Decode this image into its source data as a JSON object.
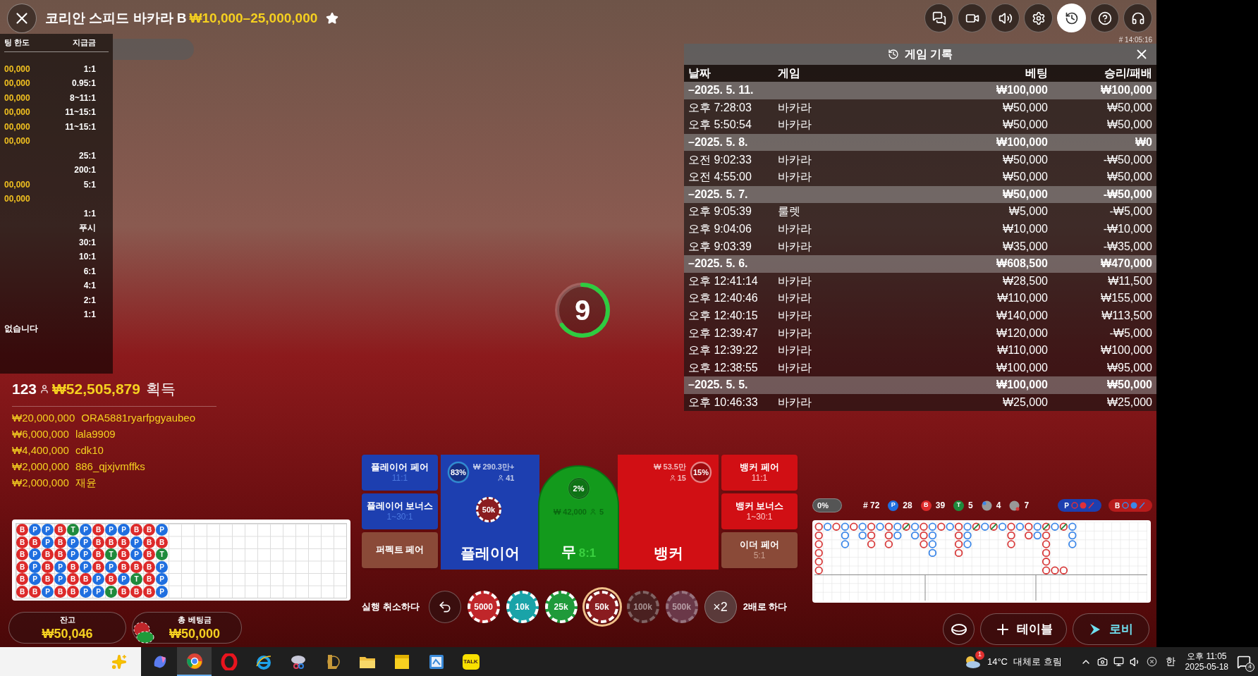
{
  "header": {
    "title": "코리안 스피드 바카라 B",
    "limits": "₩10,000–25,000,000"
  },
  "paytable": {
    "columns": [
      "팅 한도",
      "지급금"
    ],
    "rows": [
      {
        "limit": "00,000",
        "payout": "1:1"
      },
      {
        "limit": "00,000",
        "payout": "0.95:1"
      },
      {
        "limit": "00,000",
        "payout": "8~11:1"
      },
      {
        "limit": "00,000",
        "payout": "11~15:1"
      },
      {
        "limit": "00,000",
        "payout": "11~15:1"
      },
      {
        "limit": "00,000"
      },
      {
        "payout": "25:1"
      },
      {
        "payout": "200:1"
      },
      {
        "limit": "00,000",
        "payout": "5:1"
      },
      {
        "limit": "00,000"
      },
      {
        "payout": "1:1"
      },
      {
        "payout": "푸시"
      },
      {
        "payout": "30:1"
      },
      {
        "payout": "10:1"
      },
      {
        "payout": "6:1"
      },
      {
        "payout": "4:1"
      },
      {
        "payout": "2:1"
      },
      {
        "payout": "1:1"
      }
    ],
    "footer": "없습니다"
  },
  "toolbar": {
    "buttons": [
      {
        "kind": "chat",
        "selected": false
      },
      {
        "kind": "video",
        "selected": false
      },
      {
        "kind": "sound",
        "selected": false
      },
      {
        "kind": "settings",
        "selected": false
      },
      {
        "kind": "history",
        "selected": true
      },
      {
        "kind": "help",
        "selected": false
      },
      {
        "kind": "support",
        "selected": false
      }
    ],
    "round_id": "# 14:05:16"
  },
  "history": {
    "title": "게임 기록",
    "columns": [
      "날짜",
      "게임",
      "베팅",
      "승리/패배"
    ],
    "rows": [
      {
        "kind": "day",
        "date": "–2025. 5. 11.",
        "bet": "₩100,000",
        "result": "₩100,000"
      },
      {
        "kind": "entry",
        "date": "오후 7:28:03",
        "game": "바카라",
        "bet": "₩50,000",
        "result": "₩50,000"
      },
      {
        "kind": "entry",
        "date": "오후 5:50:54",
        "game": "바카라",
        "bet": "₩50,000",
        "result": "₩50,000"
      },
      {
        "kind": "day",
        "date": "–2025. 5. 8.",
        "bet": "₩100,000",
        "result": "₩0"
      },
      {
        "kind": "entry",
        "date": "오전 9:02:33",
        "game": "바카라",
        "bet": "₩50,000",
        "result": "-₩50,000"
      },
      {
        "kind": "entry",
        "date": "오전 4:55:00",
        "game": "바카라",
        "bet": "₩50,000",
        "result": "₩50,000"
      },
      {
        "kind": "day",
        "date": "–2025. 5. 7.",
        "bet": "₩50,000",
        "result": "-₩50,000"
      },
      {
        "kind": "entry",
        "date": "오후 9:05:39",
        "game": "룰렛",
        "bet": "₩5,000",
        "result": "-₩5,000"
      },
      {
        "kind": "entry",
        "date": "오후 9:04:06",
        "game": "바카라",
        "bet": "₩10,000",
        "result": "-₩10,000"
      },
      {
        "kind": "entry",
        "date": "오후 9:03:39",
        "game": "바카라",
        "bet": "₩35,000",
        "result": "-₩35,000"
      },
      {
        "kind": "day",
        "date": "–2025. 5. 6.",
        "bet": "₩608,500",
        "result": "₩470,000"
      },
      {
        "kind": "entry",
        "date": "오후 12:41:14",
        "game": "바카라",
        "bet": "₩28,500",
        "result": "₩11,500"
      },
      {
        "kind": "entry",
        "date": "오후 12:40:46",
        "game": "바카라",
        "bet": "₩110,000",
        "result": "₩155,000"
      },
      {
        "kind": "entry",
        "date": "오후 12:40:15",
        "game": "바카라",
        "bet": "₩140,000",
        "result": "₩113,500"
      },
      {
        "kind": "entry",
        "date": "오후 12:39:47",
        "game": "바카라",
        "bet": "₩120,000",
        "result": "-₩5,000"
      },
      {
        "kind": "entry",
        "date": "오후 12:39:22",
        "game": "바카라",
        "bet": "₩110,000",
        "result": "₩100,000"
      },
      {
        "kind": "entry",
        "date": "오후 12:38:55",
        "game": "바카라",
        "bet": "₩100,000",
        "result": "₩95,000"
      },
      {
        "kind": "day",
        "date": "–2025. 5. 5.",
        "bet": "₩100,000",
        "result": "₩50,000"
      },
      {
        "kind": "entry",
        "date": "오후 10:46:33",
        "game": "바카라",
        "bet": "₩25,000",
        "result": "₩25,000"
      }
    ]
  },
  "timer": {
    "value": "9",
    "level": 0.65
  },
  "winners": {
    "count": "123",
    "total": "₩52,505,879",
    "suffix": "획득",
    "list": [
      {
        "amount": "₩20,000,000",
        "name": "ORA5881ryarfpgyaubeo"
      },
      {
        "amount": "₩6,000,000",
        "name": "lala9909"
      },
      {
        "amount": "₩4,400,000",
        "name": "cdk10"
      },
      {
        "amount": "₩2,000,000",
        "name": "886_qjxjvmffks"
      },
      {
        "amount": "₩2,000,000",
        "name": "재윤"
      }
    ]
  },
  "bead_road": {
    "rows": [
      [
        {
          "kind": "banker",
          "label": "B"
        },
        {
          "kind": "player",
          "label": "P"
        },
        {
          "kind": "player",
          "label": "P"
        },
        {
          "kind": "banker",
          "label": "B"
        },
        {
          "kind": "tie",
          "label": "T"
        },
        {
          "kind": "player",
          "label": "P"
        },
        {
          "kind": "banker",
          "label": "B"
        },
        {
          "kind": "player",
          "label": "P"
        },
        {
          "kind": "player",
          "label": "P"
        },
        {
          "kind": "banker",
          "label": "B"
        },
        {
          "kind": "banker",
          "label": "B"
        },
        {
          "kind": "player",
          "label": "P"
        }
      ],
      [
        {
          "kind": "banker",
          "label": "B"
        },
        {
          "kind": "banker",
          "label": "B"
        },
        {
          "kind": "player",
          "label": "P"
        },
        {
          "kind": "banker",
          "label": "B"
        },
        {
          "kind": "player",
          "label": "P"
        },
        {
          "kind": "player",
          "label": "P"
        },
        {
          "kind": "banker",
          "label": "B"
        },
        {
          "kind": "banker",
          "label": "B"
        },
        {
          "kind": "banker",
          "label": "B"
        },
        {
          "kind": "player",
          "label": "P"
        },
        {
          "kind": "banker",
          "label": "B"
        },
        {
          "kind": "banker",
          "label": "B"
        }
      ],
      [
        {
          "kind": "banker",
          "label": "B"
        },
        {
          "kind": "player",
          "label": "P"
        },
        {
          "kind": "banker",
          "label": "B"
        },
        {
          "kind": "banker",
          "label": "B"
        },
        {
          "kind": "player",
          "label": "P"
        },
        {
          "kind": "player",
          "label": "P"
        },
        {
          "kind": "banker",
          "label": "B"
        },
        {
          "kind": "tie",
          "label": "T"
        },
        {
          "kind": "banker",
          "label": "B"
        },
        {
          "kind": "player",
          "label": "P"
        },
        {
          "kind": "banker",
          "label": "B"
        },
        {
          "kind": "tie",
          "label": "T"
        }
      ],
      [
        {
          "kind": "banker",
          "label": "B"
        },
        {
          "kind": "player",
          "label": "P"
        },
        {
          "kind": "banker",
          "label": "B"
        },
        {
          "kind": "player",
          "label": "P"
        },
        {
          "kind": "banker",
          "label": "B"
        },
        {
          "kind": "player",
          "label": "P"
        },
        {
          "kind": "banker",
          "label": "B"
        },
        {
          "kind": "player",
          "label": "P"
        },
        {
          "kind": "banker",
          "label": "B"
        },
        {
          "kind": "banker",
          "label": "B"
        },
        {
          "kind": "banker",
          "label": "B"
        },
        {
          "kind": "player",
          "label": "P"
        }
      ],
      [
        {
          "kind": "banker",
          "label": "B"
        },
        {
          "kind": "player",
          "label": "P"
        },
        {
          "kind": "banker",
          "label": "B"
        },
        {
          "kind": "player",
          "label": "P"
        },
        {
          "kind": "banker",
          "label": "B"
        },
        {
          "kind": "banker",
          "label": "B"
        },
        {
          "kind": "player",
          "label": "P"
        },
        {
          "kind": "banker",
          "label": "B"
        },
        {
          "kind": "player",
          "label": "P"
        },
        {
          "kind": "tie",
          "label": "T"
        },
        {
          "kind": "banker",
          "label": "B"
        },
        {
          "kind": "player",
          "label": "P"
        }
      ],
      [
        {
          "kind": "banker",
          "label": "B"
        },
        {
          "kind": "banker",
          "label": "B"
        },
        {
          "kind": "player",
          "label": "P"
        },
        {
          "kind": "banker",
          "label": "B"
        },
        {
          "kind": "banker",
          "label": "B"
        },
        {
          "kind": "player",
          "label": "P"
        },
        {
          "kind": "player",
          "label": "P"
        },
        {
          "kind": "tie",
          "label": "T"
        },
        {
          "kind": "banker",
          "label": "B"
        },
        {
          "kind": "banker",
          "label": "B"
        },
        {
          "kind": "banker",
          "label": "B"
        },
        {
          "kind": "player",
          "label": "P"
        }
      ]
    ]
  },
  "wallet": {
    "balance_label": "잔고",
    "balance": "₩50,046",
    "bet_label": "총 베팅금",
    "bet": "₩50,000"
  },
  "bets": {
    "side_left": [
      {
        "kind": "player",
        "name": "플레이어 페어",
        "payout": "11:1"
      },
      {
        "kind": "player",
        "name": "플레이어 보너스",
        "payout": "1~30:1"
      },
      {
        "kind": "neutral",
        "name": "퍼펙트 페어"
      }
    ],
    "main": [
      {
        "kind": "player",
        "name": "플레이어",
        "amount": "₩ 290.3만+",
        "players": "41",
        "percent": "83%",
        "chip": "50k"
      },
      {
        "kind": "tie",
        "name": "무",
        "payout": "8:1",
        "amount": "₩ 42,000",
        "players": "5",
        "percent": "2%"
      },
      {
        "kind": "banker",
        "name": "뱅커",
        "amount": "₩ 53.5만",
        "players": "15",
        "percent": "15%"
      }
    ],
    "side_right": [
      {
        "kind": "banker",
        "name": "뱅커 페어",
        "payout": "11:1"
      },
      {
        "kind": "banker",
        "name": "뱅커 보너스",
        "payout": "1~30:1"
      },
      {
        "kind": "neutral",
        "name": "이더 페어",
        "payout": "5:1"
      }
    ]
  },
  "chips": {
    "undo_label": "실행 취소하다",
    "items": [
      {
        "label": "5000",
        "color": "#c0262a",
        "selected": false,
        "disabled": false
      },
      {
        "label": "10k",
        "color": "#1aa3a8",
        "selected": false,
        "disabled": false
      },
      {
        "label": "25k",
        "color": "#1f9a3a",
        "selected": false,
        "disabled": false
      },
      {
        "label": "50k",
        "color": "#8a1c20",
        "selected": true,
        "disabled": false
      },
      {
        "label": "100k",
        "color": "#4a2020",
        "selected": false,
        "disabled": true
      },
      {
        "label": "500k",
        "color": "#6a3848",
        "selected": false,
        "disabled": true
      }
    ],
    "double": "×2",
    "double_label": "2배로 하다"
  },
  "stats": {
    "shoe_percent": "0%",
    "round": "# 72",
    "items": [
      {
        "kind": "player",
        "label": "P",
        "count": "28"
      },
      {
        "kind": "banker",
        "label": "B",
        "count": "39"
      },
      {
        "kind": "tie",
        "label": "T",
        "count": "5"
      },
      {
        "kind": "player_pair",
        "count": "4"
      },
      {
        "kind": "banker_pair",
        "count": "7"
      }
    ],
    "ask": [
      {
        "kind": "player",
        "label": "P"
      },
      {
        "kind": "banker",
        "label": "B"
      }
    ]
  },
  "nav": {
    "table": "테이블",
    "lobby": "로비"
  },
  "taskbar": {
    "apps": [
      {
        "kind": "copilot",
        "selected": false
      },
      {
        "kind": "chrome",
        "selected": true
      },
      {
        "kind": "opera",
        "selected": false
      },
      {
        "kind": "ie",
        "selected": false
      },
      {
        "kind": "snip",
        "selected": false
      },
      {
        "kind": "game",
        "selected": false
      },
      {
        "kind": "folder",
        "selected": false
      },
      {
        "kind": "notes",
        "selected": false
      },
      {
        "kind": "paint",
        "selected": false
      },
      {
        "kind": "talk",
        "selected": false,
        "label": "TALK"
      }
    ],
    "weather_badge": "1",
    "temperature": "14°C",
    "weather": "대체로 흐림",
    "ime": "한",
    "time": "오후 11:05",
    "date": "2025-05-18",
    "notifications": "4"
  }
}
